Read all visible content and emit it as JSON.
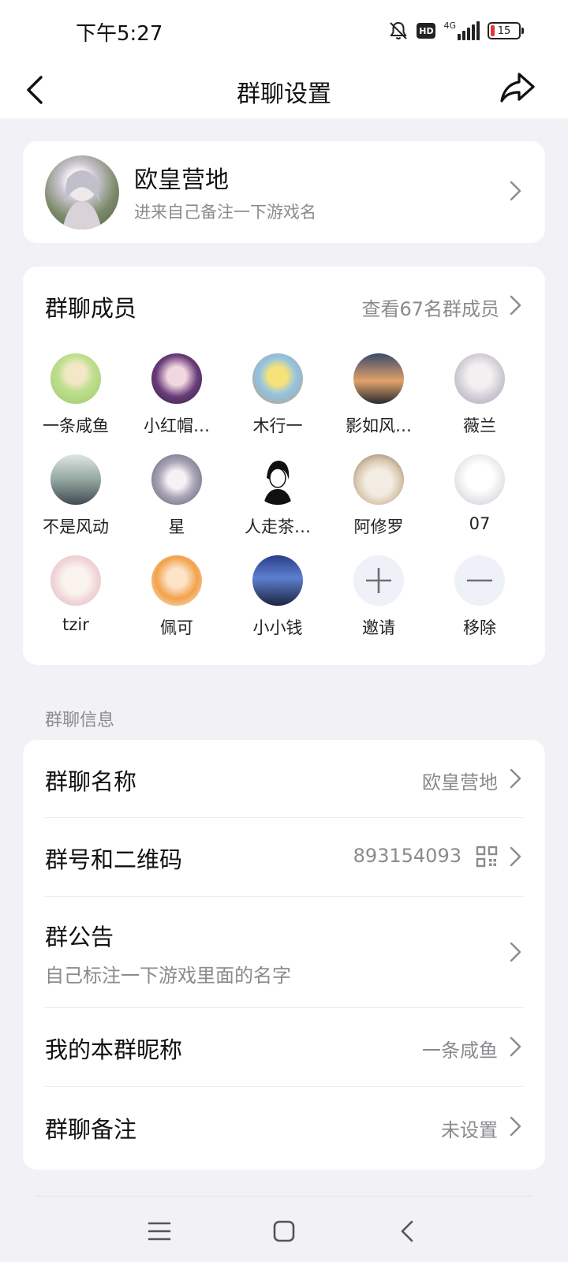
{
  "status_bar": {
    "time": "下午5:27",
    "icons": [
      "mute-bell-icon",
      "hd-icon",
      "4g-signal-icon",
      "battery-icon"
    ],
    "hd": "HD",
    "network": "4G",
    "battery": "15",
    "battery_color": "#e53935"
  },
  "header": {
    "title": "群聊设置",
    "back_icon": "chevron-left-icon",
    "share_icon": "share-icon"
  },
  "group": {
    "name": "欧皇营地",
    "description": "进来自己备注一下游戏名"
  },
  "members": {
    "title": "群聊成员",
    "view_all": "查看67名群成员",
    "list": [
      {
        "name": "一条咸鱼"
      },
      {
        "name": "小红帽…"
      },
      {
        "name": "木行一"
      },
      {
        "name": "影如风…"
      },
      {
        "name": "薇兰"
      },
      {
        "name": "不是风动"
      },
      {
        "name": "星"
      },
      {
        "name": "人走茶…"
      },
      {
        "name": "阿修罗"
      },
      {
        "name": "07"
      },
      {
        "name": "tzir"
      },
      {
        "name": "佩可"
      },
      {
        "name": "小小钱"
      }
    ],
    "invite": "邀请",
    "remove": "移除"
  },
  "info": {
    "section_label": "群聊信息",
    "name_title": "群聊名称",
    "name_value": "欧皇营地",
    "number_title": "群号和二维码",
    "number_value": "893154093",
    "announcement_title": "群公告",
    "announcement_value": "自己标注一下游戏里面的名字",
    "nickname_title": "我的本群昵称",
    "nickname_value": "一条咸鱼",
    "remark_title": "群聊备注",
    "remark_value": "未设置"
  },
  "system_nav": {
    "icons": [
      "menu-icon",
      "home-icon",
      "back-icon"
    ]
  }
}
